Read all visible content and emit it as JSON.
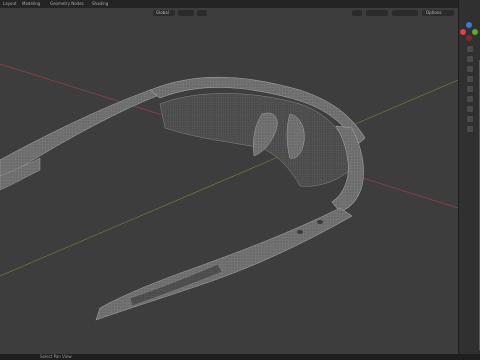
{
  "topbar": {
    "tabs": [
      "Layout",
      "Modeling",
      "Geometry Nodes",
      "Shading"
    ]
  },
  "viewport_header": {
    "mode_label": "Object Mode",
    "view_label": "Global",
    "overlay_label": "Options"
  },
  "status_bar": {
    "left_text": "Select  Pan View"
  },
  "colors": {
    "background": "#3d3d3d",
    "wire": "#8a8a8a",
    "mesh_face": "#686868",
    "axis_x": "#b8464a",
    "axis_y": "#7d9c3a",
    "gizmo_x": "#e0404a",
    "gizmo_y": "#5aaa30",
    "gizmo_z": "#3b7bd6"
  },
  "icons": [
    "cursor-icon",
    "move-icon",
    "rotate-icon",
    "scale-icon",
    "transform-icon",
    "annotate-icon",
    "measure-icon",
    "grab-hand-icon",
    "camera-icon",
    "zoom-icon"
  ]
}
